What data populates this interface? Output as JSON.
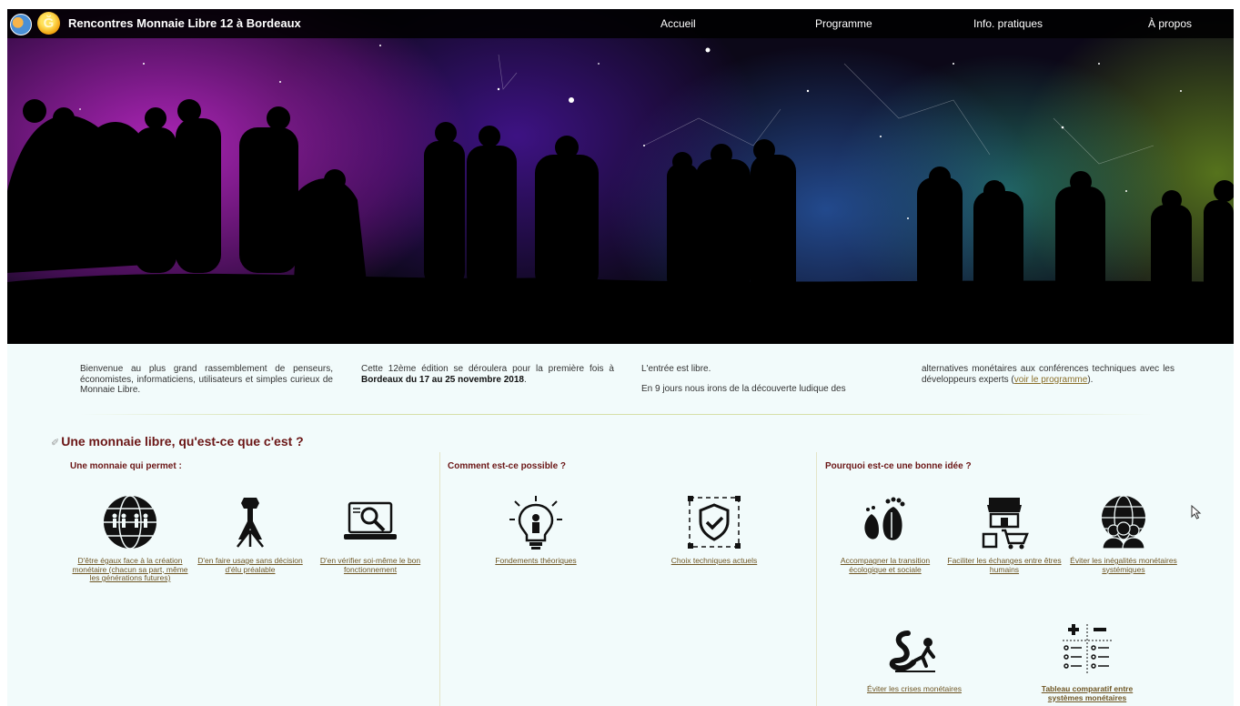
{
  "header": {
    "site_title": "Rencontres Monnaie Libre 12 à Bordeaux",
    "logo_letter": "Ğ",
    "nav": [
      "Accueil",
      "Programme",
      "Info. pratiques",
      "À propos"
    ]
  },
  "intro": {
    "col1": "Bienvenue au plus grand rassemblement de penseurs, économistes, informaticiens, utilisateurs et simples curieux de Monnaie Libre.",
    "col2_a": "Cette 12ème édition se déroulera pour la première fois à",
    "col2_b": "Bordeaux du 17 au 25 novembre 2018",
    "col2_c": ".",
    "col3_a": "L'entrée est libre.",
    "col3_b": "En 9 jours nous irons de la découverte ludique des",
    "col4_a": "alternatives monétaires aux conférences techniques avec les développeurs experts (",
    "col4_link": "voir le programme",
    "col4_b": ")."
  },
  "section": {
    "title": "Une monnaie libre, qu'est-ce que c'est ?",
    "col1_title": "Une monnaie qui permet :",
    "col2_title": "Comment est-ce possible ?",
    "col3_title": "Pourquoi est-ce une bonne idée ?"
  },
  "cards": {
    "c1": "D'être égaux face à la création monétaire (chacun sa part, même les générations futures)",
    "c2": "D'en faire usage sans décision d'élu préalable",
    "c3": "D'en vérifier soi-même le bon fonctionnement",
    "c4": "Fondements théoriques",
    "c5": "Choix techniques actuels",
    "c6": "Accompagner la transition écologique et sociale",
    "c7": "Faciliter les échanges entre êtres humains",
    "c8": "Éviter les inégalités monétaires systémiques",
    "c9": "Éviter les crises monétaires",
    "c10": "Tableau comparatif entre systèmes monétaires"
  },
  "colors": {
    "accent": "#6b1616",
    "link": "#6f5624",
    "background": "#f2fbfb"
  },
  "icons": [
    "globe-people-icon",
    "fist-roots-icon",
    "laptop-magnifier-icon",
    "lightbulb-person-icon",
    "shield-check-icon",
    "footprints-leaf-icon",
    "shop-cart-icon",
    "globe-crowd-icon",
    "snake-person-icon",
    "plus-minus-list-icon"
  ]
}
